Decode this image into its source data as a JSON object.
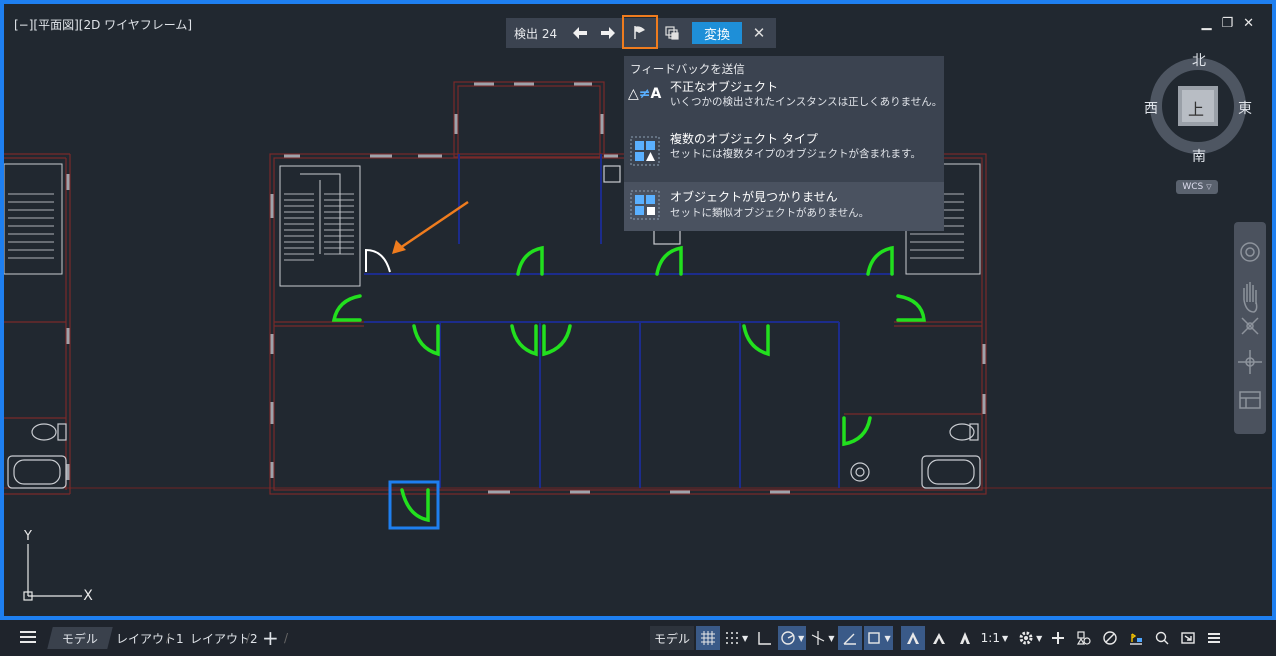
{
  "viewport": {
    "label": "[−][平面図][2D ワイヤフレーム]",
    "controls": [
      "▁",
      "❐",
      "✕"
    ]
  },
  "detect_toolbar": {
    "label": "検出 24",
    "convert_label": "変換",
    "close_glyph": "✕"
  },
  "feedback": {
    "title": "フィードバックを送信",
    "items": [
      {
        "heading": "不正なオブジェクト",
        "desc": "いくつかの検出されたインスタンスは正しくありません。",
        "icon": "incorrect-object-icon"
      },
      {
        "heading": "複数のオブジェクト タイプ",
        "desc": "セットには複数タイプのオブジェクトが含まれます。",
        "icon": "multiple-types-icon"
      },
      {
        "heading": "オブジェクトが見つかりません",
        "desc": "セットに類似オブジェクトがありません。",
        "icon": "missing-object-icon"
      }
    ]
  },
  "viewcube": {
    "north": "北",
    "south": "南",
    "east": "東",
    "west": "西",
    "top": "上",
    "wcs": "WCS"
  },
  "ucs": {
    "y": "Y",
    "x": "X"
  },
  "tabs": [
    "モデル",
    "レイアウト1",
    "レイアウト2"
  ],
  "statusbar": {
    "model_label": "モデル",
    "scale_label": "1:1"
  },
  "colors": {
    "accent": "#1e7ff0",
    "highlight": "#ef7c1e",
    "door_green": "#22e01e",
    "wall_red": "#7a2a2a",
    "wall_blue": "#1c2c8c"
  }
}
